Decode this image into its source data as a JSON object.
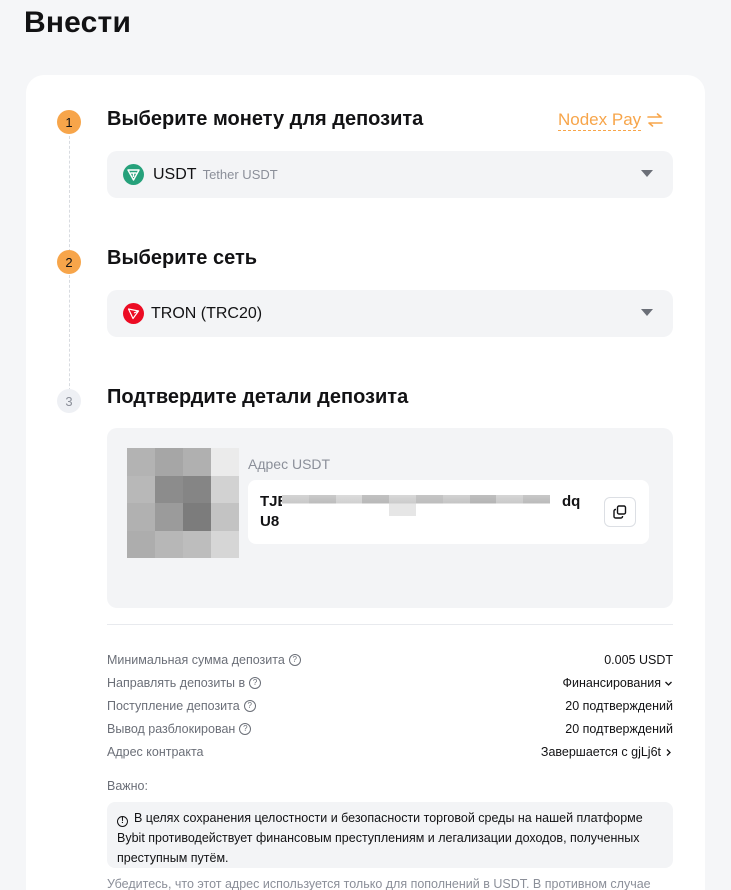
{
  "page": {
    "title": "Внести"
  },
  "steps": [
    {
      "number": "1",
      "title": "Выберите монету для депозита"
    },
    {
      "number": "2",
      "title": "Выберите сеть"
    },
    {
      "number": "3",
      "title": "Подтвердите детали депозита"
    }
  ],
  "switch_link": {
    "label": "Nodex Pay"
  },
  "coin_select": {
    "symbol": "USDT",
    "name": "Tether USDT"
  },
  "network_select": {
    "name": "TRON (TRC20)"
  },
  "deposit": {
    "address_label": "Адрес USDT",
    "address_start": "TJE",
    "address_end": "dq",
    "address_line2": "U8"
  },
  "details": [
    {
      "key": "Минимальная сумма депозита",
      "value": "0.005 USDT",
      "help": true,
      "arrow": ""
    },
    {
      "key": "Направлять депозиты в",
      "value": "Финансирования",
      "help": true,
      "arrow": "down"
    },
    {
      "key": "Поступление депозита",
      "value": "20 подтверждений",
      "help": true,
      "arrow": ""
    },
    {
      "key": "Вывод разблокирован",
      "value": "20 подтверждений",
      "help": true,
      "arrow": ""
    },
    {
      "key": "Адрес контракта",
      "value": "Завершается с gjLj6t",
      "help": false,
      "arrow": "right"
    }
  ],
  "important": {
    "label": "Важно:",
    "notice": "В целях сохранения целостности и безопасности торговой среды на нашей платформе Bybit противодействует финансовым преступлениям и легализации доходов, полученных преступным путём."
  },
  "footnote": "Убедитесь, что этот адрес используется только для пополнений в USDT. В противном случае",
  "colors": {
    "accent": "#f7a54a",
    "usdt": "#26a17b",
    "tron": "#ec0b23"
  }
}
